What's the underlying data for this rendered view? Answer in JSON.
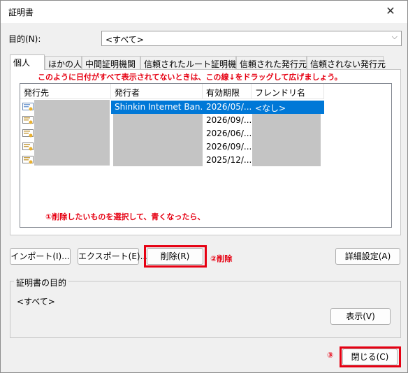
{
  "window": {
    "title": "証明書",
    "close_glyph": "✕"
  },
  "purpose": {
    "label": "目的(N):",
    "value": "<すべて>",
    "dropdown_glyph": "⌵"
  },
  "tabs": [
    {
      "label": "個人",
      "active": true
    },
    {
      "label": "ほかの人"
    },
    {
      "label": "中間証明機関"
    },
    {
      "label": "信頼されたルート証明機関"
    },
    {
      "label": "信頼された発行元"
    },
    {
      "label": "信頼されない発行元"
    }
  ],
  "annotations": {
    "top": "このように日付がすべて表示されてないときは、この線↓をドラッグして広げましょう。",
    "select": "①削除したいものを選択して、青くなったら、",
    "delete": "②削除",
    "close": "③"
  },
  "list": {
    "columns": [
      "発行先",
      "発行者",
      "有効期限",
      "フレンドリ名"
    ],
    "rows": [
      {
        "issued_to": "",
        "issuer": "Shinkin Internet Ban...",
        "expires": "2026/05/...",
        "friendly": "<なし>"
      },
      {
        "issued_to": "",
        "issuer": "",
        "expires": "2026/09/...",
        "friendly": ""
      },
      {
        "issued_to": "",
        "issuer": "",
        "expires": "2026/06/...",
        "friendly": ""
      },
      {
        "issued_to": "",
        "issuer": "",
        "expires": "2026/09/...",
        "friendly": ""
      },
      {
        "issued_to": "",
        "issuer": "",
        "expires": "2025/12/...",
        "friendly": ""
      }
    ]
  },
  "buttons": {
    "import": "インポート(I)...",
    "export": "エクスポート(E)...",
    "remove": "削除(R)",
    "advanced": "詳細設定(A)",
    "view": "表示(V)",
    "close": "閉じる(C)"
  },
  "cert_purposes": {
    "title": "証明書の目的",
    "value": "<すべて>"
  },
  "colors": {
    "selection": "#0078d7",
    "annotation": "#e60012",
    "redaction": "#c4c4c4"
  }
}
